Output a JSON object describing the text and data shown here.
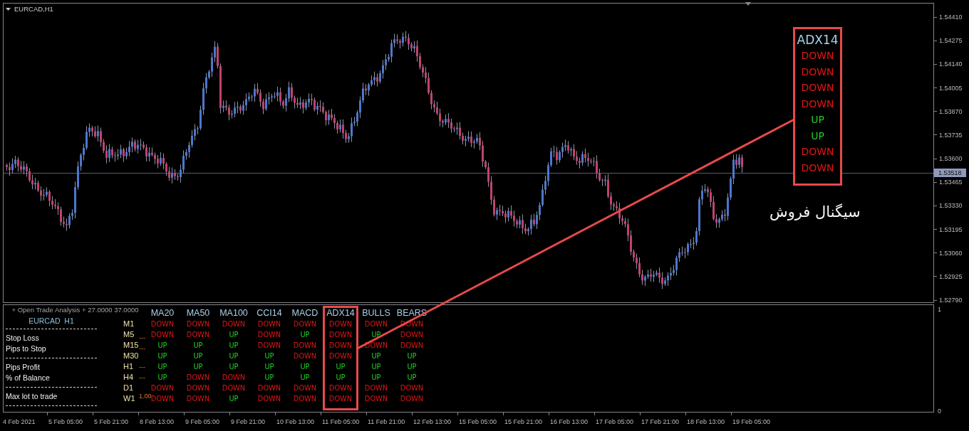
{
  "chart": {
    "title": "EURCAD,H1",
    "price_axis": [
      "1.54410",
      "1.54275",
      "1.54140",
      "1.54005",
      "1.53870",
      "1.53735",
      "1.53600",
      "1.53465",
      "1.53330",
      "1.53195",
      "1.53060",
      "1.52925",
      "1.52790"
    ],
    "current_price": "1.53518"
  },
  "indicator_panel": {
    "title": "+ Open Trade Analysis + 27.0000 37.0000",
    "symbol": "EURCAD  H1",
    "field_groups": [
      {
        "fields": [
          {
            "label": "Stop Loss",
            "value": "---"
          },
          {
            "label": "Pips to Stop",
            "value": "---"
          }
        ]
      },
      {
        "fields": [
          {
            "label": "Pips Profit",
            "value": "---"
          },
          {
            "label": "% of Balance",
            "value": "---"
          }
        ]
      },
      {
        "fields": [
          {
            "label": "Max lot to trade",
            "value": "1.00"
          }
        ]
      }
    ],
    "columns": [
      {
        "label": "MA20",
        "highlighted": false
      },
      {
        "label": "MA50",
        "highlighted": false
      },
      {
        "label": "MA100",
        "highlighted": false
      },
      {
        "label": "CCI14",
        "highlighted": false
      },
      {
        "label": "MACD",
        "highlighted": false
      },
      {
        "label": "ADX14",
        "highlighted": true
      },
      {
        "label": "BULLS",
        "highlighted": false
      },
      {
        "label": "BEARS",
        "highlighted": false
      }
    ],
    "rows": [
      {
        "timeframe": "M1",
        "cells": [
          {
            "text": "DOWN",
            "rising": false
          },
          {
            "text": "DOWN",
            "rising": false
          },
          {
            "text": "DOWN",
            "rising": false
          },
          {
            "text": "DOWN",
            "rising": false
          },
          {
            "text": "DOWN",
            "rising": false
          },
          {
            "text": "DOWN",
            "rising": false
          },
          {
            "text": "DOWN",
            "rising": false
          },
          {
            "text": "DOWN",
            "rising": false
          }
        ]
      },
      {
        "timeframe": "M5",
        "cells": [
          {
            "text": "DOWN",
            "rising": false
          },
          {
            "text": "DOWN",
            "rising": false
          },
          {
            "text": "UP",
            "rising": true
          },
          {
            "text": "DOWN",
            "rising": false
          },
          {
            "text": "UP",
            "rising": true
          },
          {
            "text": "DOWN",
            "rising": false
          },
          {
            "text": "UP",
            "rising": true
          },
          {
            "text": "DOWN",
            "rising": false
          }
        ]
      },
      {
        "timeframe": "M15",
        "cells": [
          {
            "text": "UP",
            "rising": true
          },
          {
            "text": "UP",
            "rising": true
          },
          {
            "text": "UP",
            "rising": true
          },
          {
            "text": "DOWN",
            "rising": false
          },
          {
            "text": "DOWN",
            "rising": false
          },
          {
            "text": "DOWN",
            "rising": false
          },
          {
            "text": "DOWN",
            "rising": false
          },
          {
            "text": "DOWN",
            "rising": false
          }
        ]
      },
      {
        "timeframe": "M30",
        "cells": [
          {
            "text": "UP",
            "rising": true
          },
          {
            "text": "UP",
            "rising": true
          },
          {
            "text": "UP",
            "rising": true
          },
          {
            "text": "UP",
            "rising": true
          },
          {
            "text": "DOWN",
            "rising": false
          },
          {
            "text": "DOWN",
            "rising": false
          },
          {
            "text": "UP",
            "rising": true
          },
          {
            "text": "UP",
            "rising": true
          }
        ]
      },
      {
        "timeframe": "H1",
        "cells": [
          {
            "text": "UP",
            "rising": true
          },
          {
            "text": "UP",
            "rising": true
          },
          {
            "text": "UP",
            "rising": true
          },
          {
            "text": "UP",
            "rising": true
          },
          {
            "text": "UP",
            "rising": true
          },
          {
            "text": "UP",
            "rising": true
          },
          {
            "text": "UP",
            "rising": true
          },
          {
            "text": "UP",
            "rising": true
          }
        ]
      },
      {
        "timeframe": "H4",
        "cells": [
          {
            "text": "UP",
            "rising": true
          },
          {
            "text": "DOWN",
            "rising": false
          },
          {
            "text": "DOWN",
            "rising": false
          },
          {
            "text": "UP",
            "rising": true
          },
          {
            "text": "UP",
            "rising": true
          },
          {
            "text": "UP",
            "rising": true
          },
          {
            "text": "UP",
            "rising": true
          },
          {
            "text": "UP",
            "rising": true
          }
        ]
      },
      {
        "timeframe": "D1",
        "cells": [
          {
            "text": "DOWN",
            "rising": false
          },
          {
            "text": "DOWN",
            "rising": false
          },
          {
            "text": "DOWN",
            "rising": false
          },
          {
            "text": "DOWN",
            "rising": false
          },
          {
            "text": "DOWN",
            "rising": false
          },
          {
            "text": "DOWN",
            "rising": false
          },
          {
            "text": "DOWN",
            "rising": false
          },
          {
            "text": "DOWN",
            "rising": false
          }
        ]
      },
      {
        "timeframe": "W1",
        "cells": [
          {
            "text": "DOWN",
            "rising": false
          },
          {
            "text": "DOWN",
            "rising": false
          },
          {
            "text": "UP",
            "rising": true
          },
          {
            "text": "DOWN",
            "rising": false
          },
          {
            "text": "DOWN",
            "rising": false
          },
          {
            "text": "DOWN",
            "rising": false
          },
          {
            "text": "DOWN",
            "rising": false
          },
          {
            "text": "DOWN",
            "rising": false
          }
        ]
      }
    ],
    "axis": [
      "1",
      "0"
    ]
  },
  "callout": {
    "title": "ADX14",
    "values": [
      {
        "text": "DOWN",
        "rising": false
      },
      {
        "text": "DOWN",
        "rising": false
      },
      {
        "text": "DOWN",
        "rising": false
      },
      {
        "text": "DOWN",
        "rising": false
      },
      {
        "text": "UP",
        "rising": true
      },
      {
        "text": "UP",
        "rising": true
      },
      {
        "text": "DOWN",
        "rising": false
      },
      {
        "text": "DOWN",
        "rising": false
      }
    ],
    "caption": "سیگنال فروش"
  },
  "time_axis": [
    "4 Feb 2021",
    "5 Feb 05:00",
    "5 Feb 21:00",
    "8 Feb 13:00",
    "9 Feb 05:00",
    "9 Feb 21:00",
    "10 Feb 13:00",
    "11 Feb 05:00",
    "11 Feb 21:00",
    "12 Feb 13:00",
    "15 Feb 05:00",
    "15 Feb 21:00",
    "16 Feb 13:00",
    "17 Feb 05:00",
    "17 Feb 21:00",
    "18 Feb 13:00",
    "19 Feb 05:00"
  ]
}
